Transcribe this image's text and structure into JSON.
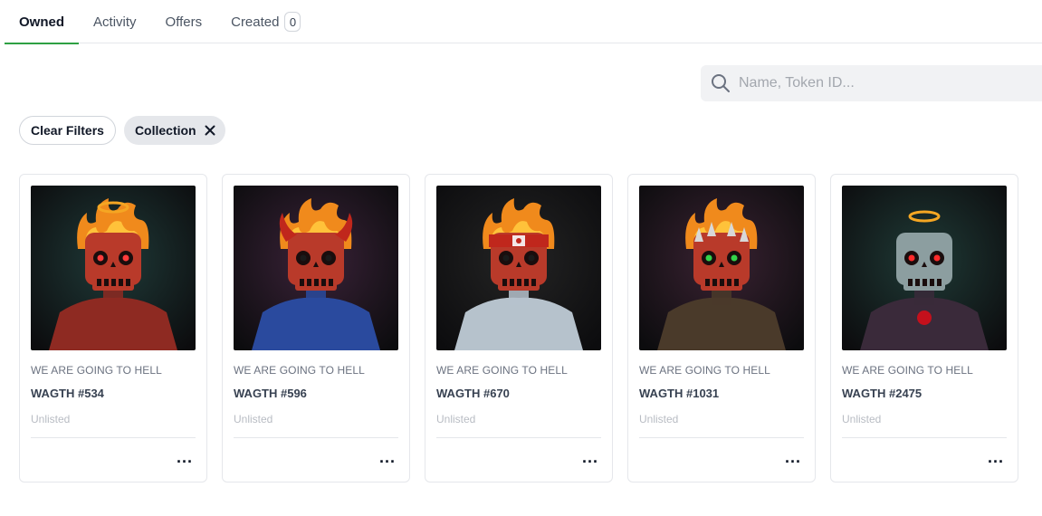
{
  "tabs": [
    {
      "label": "Owned",
      "active": true
    },
    {
      "label": "Activity",
      "active": false
    },
    {
      "label": "Offers",
      "active": false
    },
    {
      "label": "Created",
      "active": false,
      "badge": "0"
    }
  ],
  "search": {
    "placeholder": "Name, Token ID...",
    "icon": "search-icon"
  },
  "filters": {
    "clear_label": "Clear Filters",
    "active": [
      {
        "label": "Collection",
        "icon": "close-icon"
      }
    ]
  },
  "cards": [
    {
      "collection": "WE ARE GOING TO HELL",
      "name": "WAGTH #534",
      "status": "Unlisted",
      "more": "...",
      "art": {
        "bg": "#1f3a38",
        "skull": "#b93a2a",
        "eyes": "#ff3b3b",
        "body": "#8e2a22",
        "accessory": "halo-fire"
      }
    },
    {
      "collection": "WE ARE GOING TO HELL",
      "name": "WAGTH #596",
      "status": "Unlisted",
      "more": "...",
      "art": {
        "bg": "#3a2238",
        "skull": "#b93a2a",
        "eyes": "#1a1a1a",
        "body": "#2a4a9e",
        "accessory": "horns"
      }
    },
    {
      "collection": "WE ARE GOING TO HELL",
      "name": "WAGTH #670",
      "status": "Unlisted",
      "more": "...",
      "art": {
        "bg": "#242424",
        "skull": "#b93a2a",
        "eyes": "#1a1a1a",
        "body": "#b6c2cc",
        "accessory": "bandana"
      }
    },
    {
      "collection": "WE ARE GOING TO HELL",
      "name": "WAGTH #1031",
      "status": "Unlisted",
      "more": "...",
      "art": {
        "bg": "#3a2232",
        "skull": "#b93a2a",
        "eyes": "#34d34a",
        "body": "#4a3a2a",
        "accessory": "spikes"
      }
    },
    {
      "collection": "WE ARE GOING TO HELL",
      "name": "WAGTH #2475",
      "status": "Unlisted",
      "more": "...",
      "art": {
        "bg": "#1f3a36",
        "skull": "#8c9ea0",
        "eyes": "#ff2a2a",
        "body": "#3a2a3a",
        "accessory": "halo"
      }
    }
  ],
  "colors": {
    "accent": "#2ea043"
  }
}
